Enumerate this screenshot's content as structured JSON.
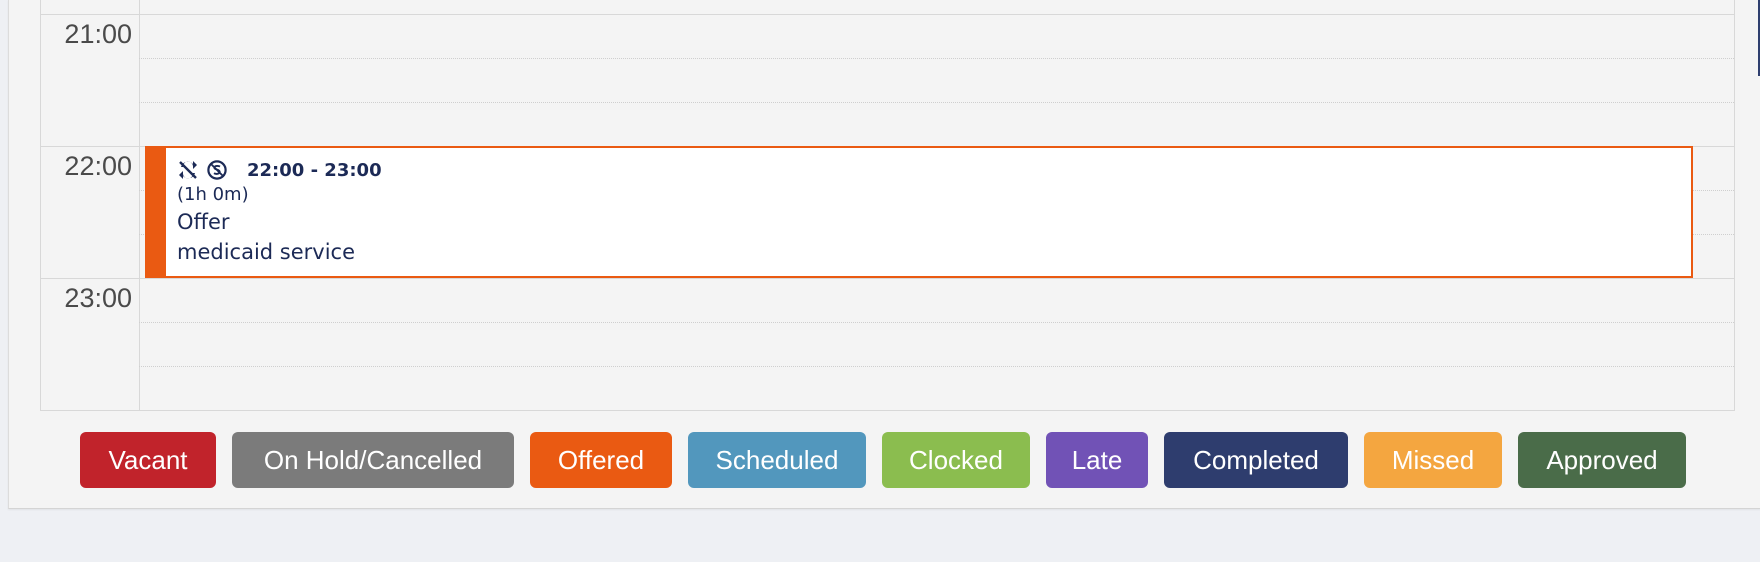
{
  "calendar": {
    "time_labels": [
      "21:00",
      "22:00",
      "23:00"
    ]
  },
  "event": {
    "icons": [
      "sync-disabled-icon",
      "currency-circle-icon"
    ],
    "time_range": "22:00 - 23:00",
    "duration": "(1h 0m)",
    "status": "Offer",
    "service": "medicaid service",
    "color": "#ea5a12"
  },
  "legend": [
    {
      "label": "Vacant",
      "color": "#c1232b"
    },
    {
      "label": "On Hold/Cancelled",
      "color": "#7b7b7b"
    },
    {
      "label": "Offered",
      "color": "#ea5a12"
    },
    {
      "label": "Scheduled",
      "color": "#5297bd"
    },
    {
      "label": "Clocked",
      "color": "#8bbd4f"
    },
    {
      "label": "Late",
      "color": "#7152b6"
    },
    {
      "label": "Completed",
      "color": "#2e3d6e"
    },
    {
      "label": "Missed",
      "color": "#f4a640"
    },
    {
      "label": "Approved",
      "color": "#4a6c49"
    }
  ]
}
